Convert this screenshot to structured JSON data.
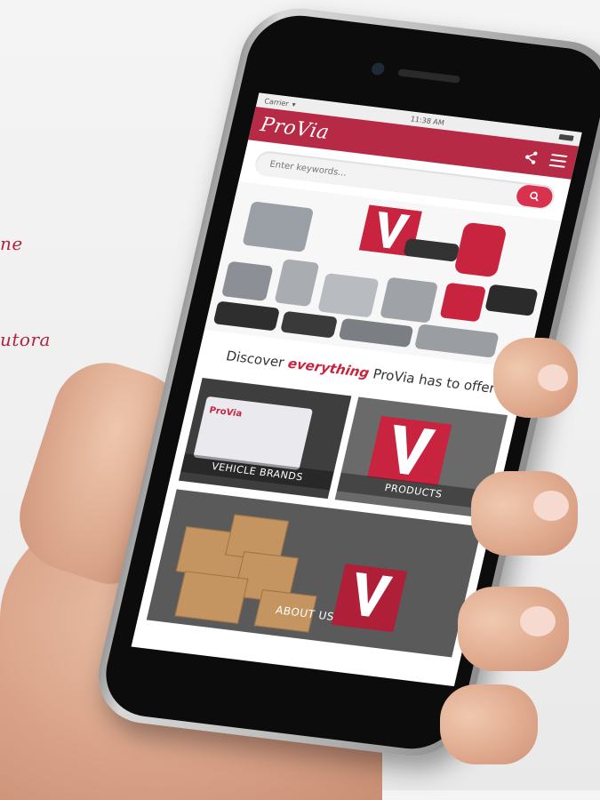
{
  "background_text": {
    "line1": "ne",
    "line2": "utora"
  },
  "status_bar": {
    "carrier": "Carrier",
    "time": "11:38 AM"
  },
  "app_bar": {
    "logo": "ProVia"
  },
  "search": {
    "placeholder": "Enter keywords..."
  },
  "discover": {
    "prefix": "Discover",
    "emphasis": "everything",
    "suffix": "ProVia has to offer"
  },
  "tiles": [
    {
      "label": "VEHICLE BRANDS",
      "tag": "ProVia"
    },
    {
      "label": "PRODUCTS"
    }
  ],
  "about": {
    "label": "ABOUT US"
  },
  "colors": {
    "brand": "#b62a45",
    "accent": "#d8324f"
  }
}
